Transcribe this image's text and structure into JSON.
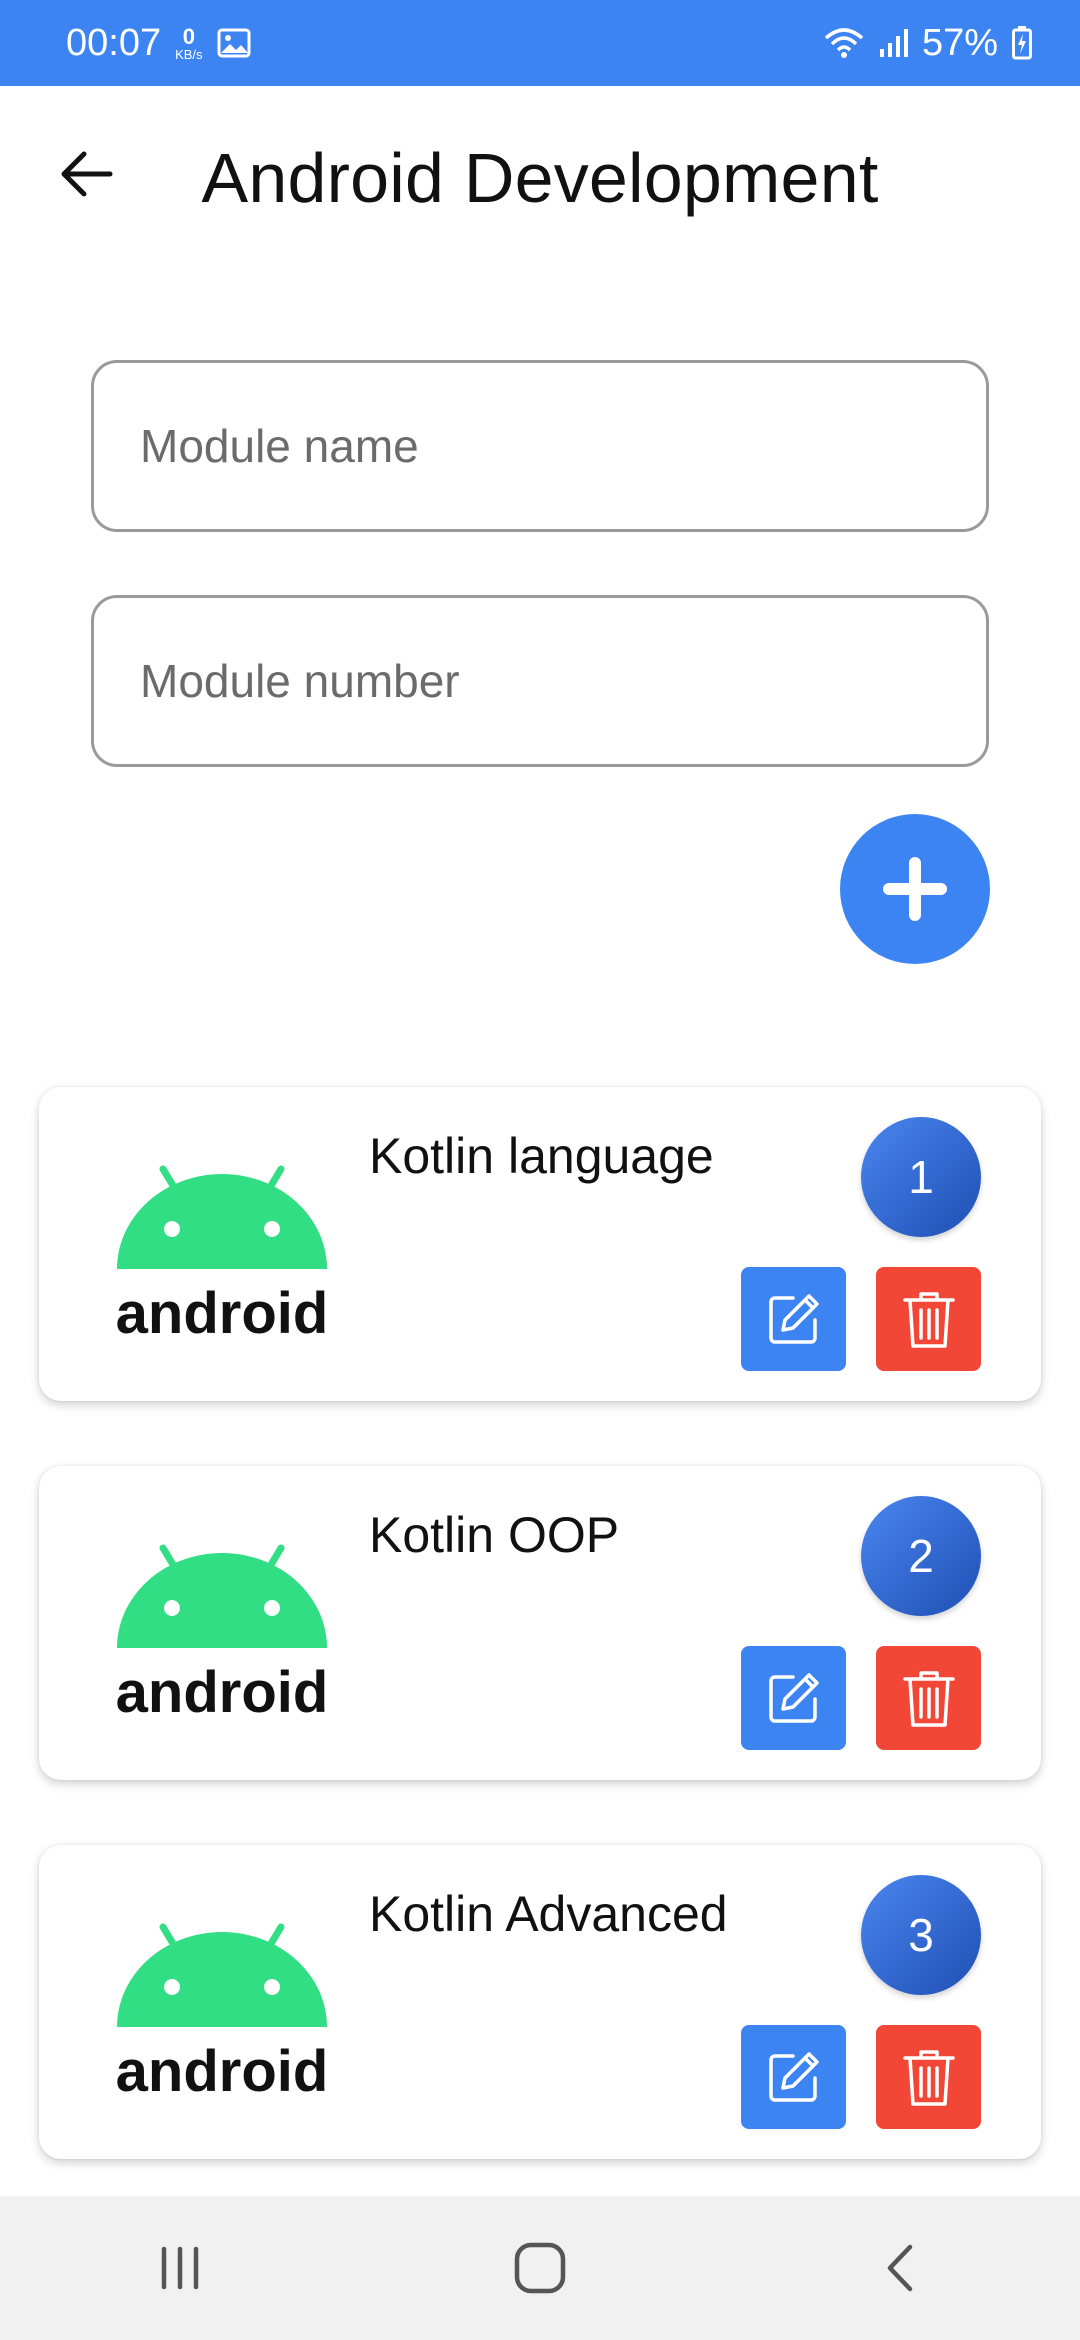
{
  "status_bar": {
    "time": "00:07",
    "speed_value": "0",
    "speed_unit": "KB/s",
    "battery": "57%",
    "icons": [
      "image-icon",
      "wifi-icon",
      "signal-icon",
      "battery-charging-icon"
    ]
  },
  "header": {
    "title": "Android Development",
    "back_icon": "arrow-left-icon"
  },
  "form": {
    "module_name_placeholder": "Module name",
    "module_number_placeholder": "Module number",
    "module_name_value": "",
    "module_number_value": "",
    "add_icon": "plus-icon"
  },
  "modules": [
    {
      "title": "Kotlin  language",
      "number": "1",
      "logo_text": "android"
    },
    {
      "title": "Kotlin OOP",
      "number": "2",
      "logo_text": "android"
    },
    {
      "title": "Kotlin Advanced",
      "number": "3",
      "logo_text": "android"
    }
  ],
  "colors": {
    "primary": "#3D84F3",
    "delete": "#F24636",
    "android_green": "#32DE84",
    "badge_gradient_start": "#4a86ef",
    "badge_gradient_end": "#1f4fb4"
  },
  "nav": {
    "icons": [
      "recent-apps-icon",
      "home-icon",
      "back-icon"
    ]
  }
}
